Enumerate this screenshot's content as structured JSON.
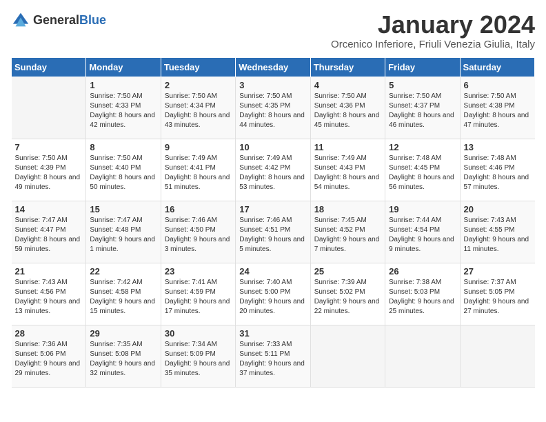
{
  "logo": {
    "general": "General",
    "blue": "Blue"
  },
  "title": "January 2024",
  "location": "Orcenico Inferiore, Friuli Venezia Giulia, Italy",
  "days_header": [
    "Sunday",
    "Monday",
    "Tuesday",
    "Wednesday",
    "Thursday",
    "Friday",
    "Saturday"
  ],
  "weeks": [
    [
      {
        "day": "",
        "sunrise": "",
        "sunset": "",
        "daylight": ""
      },
      {
        "day": "1",
        "sunrise": "Sunrise: 7:50 AM",
        "sunset": "Sunset: 4:33 PM",
        "daylight": "Daylight: 8 hours and 42 minutes."
      },
      {
        "day": "2",
        "sunrise": "Sunrise: 7:50 AM",
        "sunset": "Sunset: 4:34 PM",
        "daylight": "Daylight: 8 hours and 43 minutes."
      },
      {
        "day": "3",
        "sunrise": "Sunrise: 7:50 AM",
        "sunset": "Sunset: 4:35 PM",
        "daylight": "Daylight: 8 hours and 44 minutes."
      },
      {
        "day": "4",
        "sunrise": "Sunrise: 7:50 AM",
        "sunset": "Sunset: 4:36 PM",
        "daylight": "Daylight: 8 hours and 45 minutes."
      },
      {
        "day": "5",
        "sunrise": "Sunrise: 7:50 AM",
        "sunset": "Sunset: 4:37 PM",
        "daylight": "Daylight: 8 hours and 46 minutes."
      },
      {
        "day": "6",
        "sunrise": "Sunrise: 7:50 AM",
        "sunset": "Sunset: 4:38 PM",
        "daylight": "Daylight: 8 hours and 47 minutes."
      }
    ],
    [
      {
        "day": "7",
        "sunrise": "Sunrise: 7:50 AM",
        "sunset": "Sunset: 4:39 PM",
        "daylight": "Daylight: 8 hours and 49 minutes."
      },
      {
        "day": "8",
        "sunrise": "Sunrise: 7:50 AM",
        "sunset": "Sunset: 4:40 PM",
        "daylight": "Daylight: 8 hours and 50 minutes."
      },
      {
        "day": "9",
        "sunrise": "Sunrise: 7:49 AM",
        "sunset": "Sunset: 4:41 PM",
        "daylight": "Daylight: 8 hours and 51 minutes."
      },
      {
        "day": "10",
        "sunrise": "Sunrise: 7:49 AM",
        "sunset": "Sunset: 4:42 PM",
        "daylight": "Daylight: 8 hours and 53 minutes."
      },
      {
        "day": "11",
        "sunrise": "Sunrise: 7:49 AM",
        "sunset": "Sunset: 4:43 PM",
        "daylight": "Daylight: 8 hours and 54 minutes."
      },
      {
        "day": "12",
        "sunrise": "Sunrise: 7:48 AM",
        "sunset": "Sunset: 4:45 PM",
        "daylight": "Daylight: 8 hours and 56 minutes."
      },
      {
        "day": "13",
        "sunrise": "Sunrise: 7:48 AM",
        "sunset": "Sunset: 4:46 PM",
        "daylight": "Daylight: 8 hours and 57 minutes."
      }
    ],
    [
      {
        "day": "14",
        "sunrise": "Sunrise: 7:47 AM",
        "sunset": "Sunset: 4:47 PM",
        "daylight": "Daylight: 8 hours and 59 minutes."
      },
      {
        "day": "15",
        "sunrise": "Sunrise: 7:47 AM",
        "sunset": "Sunset: 4:48 PM",
        "daylight": "Daylight: 9 hours and 1 minute."
      },
      {
        "day": "16",
        "sunrise": "Sunrise: 7:46 AM",
        "sunset": "Sunset: 4:50 PM",
        "daylight": "Daylight: 9 hours and 3 minutes."
      },
      {
        "day": "17",
        "sunrise": "Sunrise: 7:46 AM",
        "sunset": "Sunset: 4:51 PM",
        "daylight": "Daylight: 9 hours and 5 minutes."
      },
      {
        "day": "18",
        "sunrise": "Sunrise: 7:45 AM",
        "sunset": "Sunset: 4:52 PM",
        "daylight": "Daylight: 9 hours and 7 minutes."
      },
      {
        "day": "19",
        "sunrise": "Sunrise: 7:44 AM",
        "sunset": "Sunset: 4:54 PM",
        "daylight": "Daylight: 9 hours and 9 minutes."
      },
      {
        "day": "20",
        "sunrise": "Sunrise: 7:43 AM",
        "sunset": "Sunset: 4:55 PM",
        "daylight": "Daylight: 9 hours and 11 minutes."
      }
    ],
    [
      {
        "day": "21",
        "sunrise": "Sunrise: 7:43 AM",
        "sunset": "Sunset: 4:56 PM",
        "daylight": "Daylight: 9 hours and 13 minutes."
      },
      {
        "day": "22",
        "sunrise": "Sunrise: 7:42 AM",
        "sunset": "Sunset: 4:58 PM",
        "daylight": "Daylight: 9 hours and 15 minutes."
      },
      {
        "day": "23",
        "sunrise": "Sunrise: 7:41 AM",
        "sunset": "Sunset: 4:59 PM",
        "daylight": "Daylight: 9 hours and 17 minutes."
      },
      {
        "day": "24",
        "sunrise": "Sunrise: 7:40 AM",
        "sunset": "Sunset: 5:00 PM",
        "daylight": "Daylight: 9 hours and 20 minutes."
      },
      {
        "day": "25",
        "sunrise": "Sunrise: 7:39 AM",
        "sunset": "Sunset: 5:02 PM",
        "daylight": "Daylight: 9 hours and 22 minutes."
      },
      {
        "day": "26",
        "sunrise": "Sunrise: 7:38 AM",
        "sunset": "Sunset: 5:03 PM",
        "daylight": "Daylight: 9 hours and 25 minutes."
      },
      {
        "day": "27",
        "sunrise": "Sunrise: 7:37 AM",
        "sunset": "Sunset: 5:05 PM",
        "daylight": "Daylight: 9 hours and 27 minutes."
      }
    ],
    [
      {
        "day": "28",
        "sunrise": "Sunrise: 7:36 AM",
        "sunset": "Sunset: 5:06 PM",
        "daylight": "Daylight: 9 hours and 29 minutes."
      },
      {
        "day": "29",
        "sunrise": "Sunrise: 7:35 AM",
        "sunset": "Sunset: 5:08 PM",
        "daylight": "Daylight: 9 hours and 32 minutes."
      },
      {
        "day": "30",
        "sunrise": "Sunrise: 7:34 AM",
        "sunset": "Sunset: 5:09 PM",
        "daylight": "Daylight: 9 hours and 35 minutes."
      },
      {
        "day": "31",
        "sunrise": "Sunrise: 7:33 AM",
        "sunset": "Sunset: 5:11 PM",
        "daylight": "Daylight: 9 hours and 37 minutes."
      },
      {
        "day": "",
        "sunrise": "",
        "sunset": "",
        "daylight": ""
      },
      {
        "day": "",
        "sunrise": "",
        "sunset": "",
        "daylight": ""
      },
      {
        "day": "",
        "sunrise": "",
        "sunset": "",
        "daylight": ""
      }
    ]
  ]
}
